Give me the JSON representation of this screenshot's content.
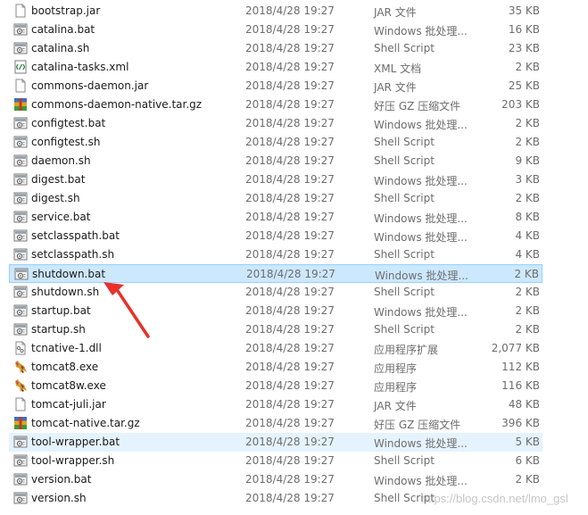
{
  "files": [
    {
      "name": "bootstrap.jar",
      "date": "2018/4/28 19:27",
      "type": "JAR 文件",
      "size": "35 KB",
      "icon": "jar-file-icon"
    },
    {
      "name": "catalina.bat",
      "date": "2018/4/28 19:27",
      "type": "Windows 批处理...",
      "size": "16 KB",
      "icon": "bat-file-icon"
    },
    {
      "name": "catalina.sh",
      "date": "2018/4/28 19:27",
      "type": "Shell Script",
      "size": "23 KB",
      "icon": "sh-file-icon"
    },
    {
      "name": "catalina-tasks.xml",
      "date": "2018/4/28 19:27",
      "type": "XML 文档",
      "size": "2 KB",
      "icon": "xml-file-icon"
    },
    {
      "name": "commons-daemon.jar",
      "date": "2018/4/28 19:27",
      "type": "JAR 文件",
      "size": "25 KB",
      "icon": "jar-file-icon"
    },
    {
      "name": "commons-daemon-native.tar.gz",
      "date": "2018/4/28 19:27",
      "type": "好压 GZ 压缩文件",
      "size": "203 KB",
      "icon": "archive-file-icon"
    },
    {
      "name": "configtest.bat",
      "date": "2018/4/28 19:27",
      "type": "Windows 批处理...",
      "size": "2 KB",
      "icon": "bat-file-icon"
    },
    {
      "name": "configtest.sh",
      "date": "2018/4/28 19:27",
      "type": "Shell Script",
      "size": "2 KB",
      "icon": "sh-file-icon"
    },
    {
      "name": "daemon.sh",
      "date": "2018/4/28 19:27",
      "type": "Shell Script",
      "size": "9 KB",
      "icon": "sh-file-icon"
    },
    {
      "name": "digest.bat",
      "date": "2018/4/28 19:27",
      "type": "Windows 批处理...",
      "size": "3 KB",
      "icon": "bat-file-icon"
    },
    {
      "name": "digest.sh",
      "date": "2018/4/28 19:27",
      "type": "Shell Script",
      "size": "2 KB",
      "icon": "sh-file-icon"
    },
    {
      "name": "service.bat",
      "date": "2018/4/28 19:27",
      "type": "Windows 批处理...",
      "size": "8 KB",
      "icon": "bat-file-icon"
    },
    {
      "name": "setclasspath.bat",
      "date": "2018/4/28 19:27",
      "type": "Windows 批处理...",
      "size": "4 KB",
      "icon": "bat-file-icon"
    },
    {
      "name": "setclasspath.sh",
      "date": "2018/4/28 19:27",
      "type": "Shell Script",
      "size": "4 KB",
      "icon": "sh-file-icon"
    },
    {
      "name": "shutdown.bat",
      "date": "2018/4/28 19:27",
      "type": "Windows 批处理...",
      "size": "2 KB",
      "icon": "bat-file-icon",
      "state": "selected"
    },
    {
      "name": "shutdown.sh",
      "date": "2018/4/28 19:27",
      "type": "Shell Script",
      "size": "2 KB",
      "icon": "sh-file-icon"
    },
    {
      "name": "startup.bat",
      "date": "2018/4/28 19:27",
      "type": "Windows 批处理...",
      "size": "2 KB",
      "icon": "bat-file-icon"
    },
    {
      "name": "startup.sh",
      "date": "2018/4/28 19:27",
      "type": "Shell Script",
      "size": "2 KB",
      "icon": "sh-file-icon"
    },
    {
      "name": "tcnative-1.dll",
      "date": "2018/4/28 19:27",
      "type": "应用程序扩展",
      "size": "2,077 KB",
      "icon": "dll-file-icon"
    },
    {
      "name": "tomcat8.exe",
      "date": "2018/4/28 19:27",
      "type": "应用程序",
      "size": "112 KB",
      "icon": "tomcat-exe-icon"
    },
    {
      "name": "tomcat8w.exe",
      "date": "2018/4/28 19:27",
      "type": "应用程序",
      "size": "116 KB",
      "icon": "tomcat-exe-icon"
    },
    {
      "name": "tomcat-juli.jar",
      "date": "2018/4/28 19:27",
      "type": "JAR 文件",
      "size": "48 KB",
      "icon": "jar-file-icon"
    },
    {
      "name": "tomcat-native.tar.gz",
      "date": "2018/4/28 19:27",
      "type": "好压 GZ 压缩文件",
      "size": "396 KB",
      "icon": "archive-file-icon"
    },
    {
      "name": "tool-wrapper.bat",
      "date": "2018/4/28 19:27",
      "type": "Windows 批处理...",
      "size": "5 KB",
      "icon": "bat-file-icon",
      "state": "hover"
    },
    {
      "name": "tool-wrapper.sh",
      "date": "2018/4/28 19:27",
      "type": "Shell Script",
      "size": "6 KB",
      "icon": "sh-file-icon"
    },
    {
      "name": "version.bat",
      "date": "2018/4/28 19:27",
      "type": "Windows 批处理...",
      "size": "2 KB",
      "icon": "bat-file-icon"
    },
    {
      "name": "version.sh",
      "date": "2018/4/28 19:27",
      "type": "Shell Script",
      "size": "",
      "icon": "sh-file-icon"
    }
  ],
  "watermark": "https://blog.csdn.net/lmo_gsl",
  "colors": {
    "selected_bg": "#cce8ff",
    "selected_border": "#99d1ff",
    "hover_bg": "#e5f3ff",
    "arrow": "#e8302a"
  }
}
